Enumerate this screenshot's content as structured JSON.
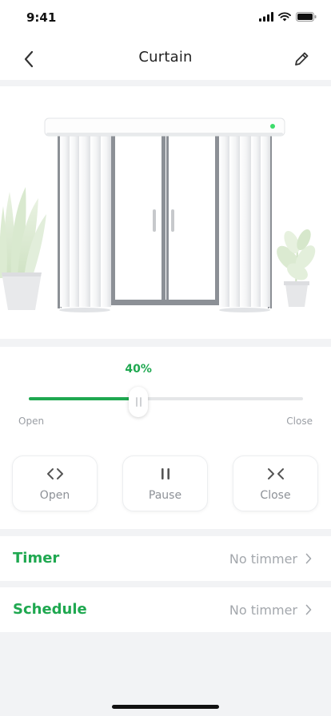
{
  "status_bar": {
    "time": "9:41"
  },
  "nav": {
    "title": "Curtain"
  },
  "control": {
    "position_label": "40%",
    "position_percent": 40,
    "open_label": "Open",
    "close_label": "Close"
  },
  "actions": [
    {
      "label": "Open",
      "icon": "open-arrows-icon"
    },
    {
      "label": "Pause",
      "icon": "pause-icon"
    },
    {
      "label": "Close",
      "icon": "close-arrows-icon"
    }
  ],
  "settings": {
    "timer": {
      "title": "Timer",
      "value": "No timmer"
    },
    "schedule": {
      "title": "Schedule",
      "value": "No timmer"
    }
  },
  "colors": {
    "accent": "#1fa850",
    "muted_text": "#a3a7ac",
    "background": "#f2f3f5",
    "indicator_led": "#3ddc6b"
  }
}
